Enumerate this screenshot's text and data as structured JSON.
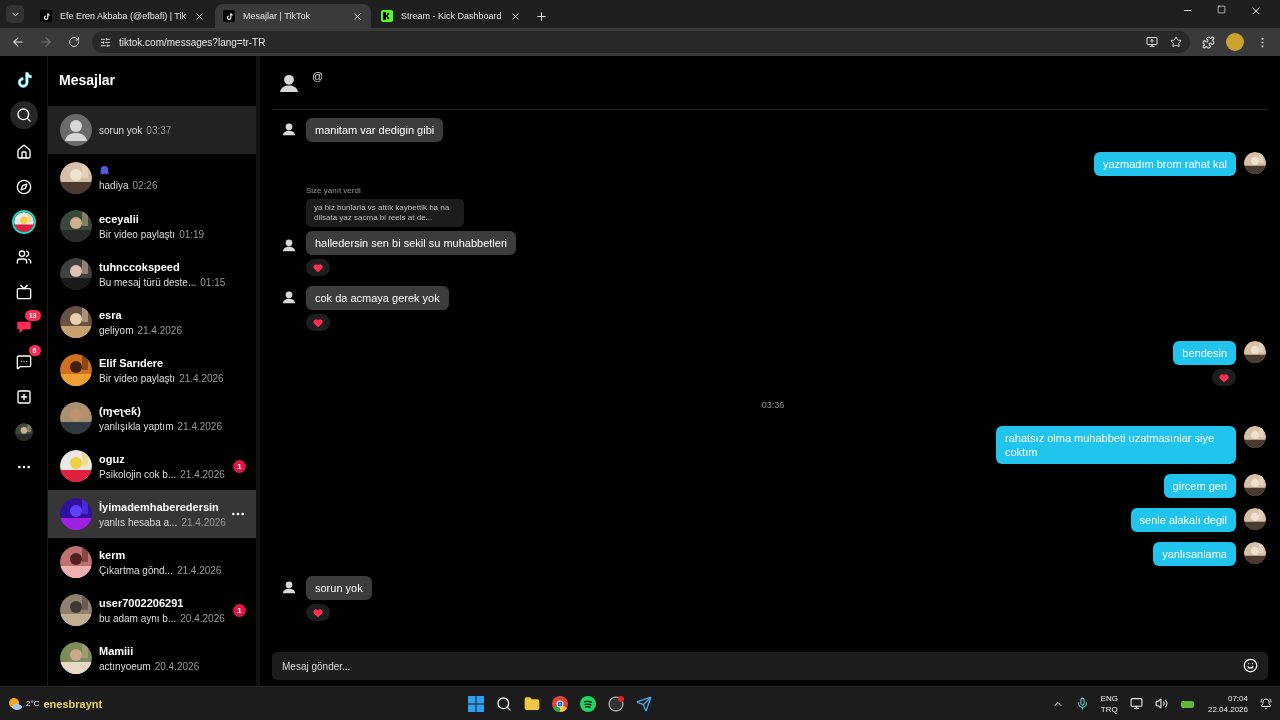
{
  "browser": {
    "tabs": [
      {
        "title": "Efe Eren Akbaba (@efbafi) | Tik",
        "kind": "tiktok",
        "selected": false
      },
      {
        "title": "Mesajlar | TikTok",
        "kind": "tiktok",
        "selected": true
      },
      {
        "title": "Stream - Kick Dashboard",
        "kind": "kick",
        "selected": false
      }
    ],
    "address": "tiktok.com/messages?lang=tr-TR"
  },
  "rail": [
    {
      "kind": "logo"
    },
    {
      "kind": "search",
      "selected": true
    },
    {
      "kind": "home"
    },
    {
      "kind": "explore"
    },
    {
      "kind": "live"
    },
    {
      "kind": "friends"
    },
    {
      "kind": "tv"
    },
    {
      "kind": "activity",
      "badge": "13"
    },
    {
      "kind": "inbox",
      "badge": "6"
    },
    {
      "kind": "upload"
    },
    {
      "kind": "profile"
    },
    {
      "kind": "more"
    }
  ],
  "inbox": {
    "title": "Mesajlar",
    "conversations": [
      {
        "kind": "no-name",
        "preview": "sorun yok",
        "time": "03:37",
        "selected": true,
        "hovered": false
      },
      {
        "kind": "icon-name",
        "preview": "hadiya",
        "time": "02:26",
        "selected": false,
        "hovered": false
      },
      {
        "kind": "text-name",
        "name": "eceyalii",
        "preview": "Bir video paylaştı",
        "time": "01:19",
        "selected": false,
        "hovered": false
      },
      {
        "kind": "text-name",
        "name": "tuhnccokspeed",
        "preview": "Bu mesaj türü deste...",
        "time": "01:15",
        "selected": false,
        "hovered": false
      },
      {
        "kind": "text-name",
        "name": "esra",
        "preview": "geliyom",
        "time": "21.4.2026",
        "selected": false,
        "hovered": false
      },
      {
        "kind": "text-name",
        "name": "Elif Sarıdere",
        "preview": "Bir video paylaştı",
        "time": "21.4.2026",
        "selected": false,
        "hovered": false
      },
      {
        "kind": "text-name",
        "name": "(ɱҽʅҽƙ)",
        "preview": "yanlışıkla yaptım",
        "time": "21.4.2026",
        "selected": false,
        "hovered": false
      },
      {
        "kind": "text-name",
        "name": "oguz",
        "preview": "Psikolojin cok b...",
        "time": "21.4.2026",
        "badge": "1",
        "selected": false,
        "hovered": false
      },
      {
        "kind": "text-name",
        "name": "İyimademhaberedersin",
        "preview": "yanlıs hesaba a...",
        "time": "21.4.2026",
        "selected": false,
        "hovered": true
      },
      {
        "kind": "text-name",
        "name": "kerm",
        "preview": "Çıkartma gönd...",
        "time": "21.4.2026",
        "selected": false,
        "hovered": false
      },
      {
        "kind": "text-name",
        "name": "user7002206291",
        "preview": "bu adam aynı b...",
        "time": "20.4.2026",
        "badge": "1",
        "selected": false,
        "hovered": false
      },
      {
        "kind": "text-name",
        "name": "Mamiii",
        "preview": "actınyoeum",
        "time": "20.4.2026",
        "selected": false,
        "hovered": false
      }
    ]
  },
  "chat": {
    "handle": "@",
    "messages": [
      {
        "kind": "incoming",
        "text": "manitam var dedigin gibi"
      },
      {
        "kind": "outgoing",
        "text": "yazmadım brom rahat kal"
      },
      {
        "kind": "incoming",
        "reply_label": "Size yanıt verdi",
        "quote": "ya biz bunlarla vs attık kaybettik ba na dilsata yaz sacma bi reels at de...",
        "text": "halledersin sen bi sekil su muhabbetleri",
        "reacted": true
      },
      {
        "kind": "incoming",
        "text": "cok da acmaya gerek yok",
        "reacted": true
      },
      {
        "kind": "outgoing",
        "text": "bendesin",
        "reacted": true
      },
      {
        "kind": "time",
        "text": "03:36"
      },
      {
        "kind": "outgoing",
        "text": "rahatsız olma muhabbeti uzatmasınlar siye coktım"
      },
      {
        "kind": "outgoing",
        "text": "gircem geri"
      },
      {
        "kind": "outgoing",
        "text": "senle alakalı degil"
      },
      {
        "kind": "outgoing",
        "text": "yanlısanlama"
      },
      {
        "kind": "incoming",
        "text": "sorun yok",
        "reacted": true
      }
    ],
    "input": {
      "placeholder": "Mesaj gönder..."
    }
  },
  "taskbar": {
    "weather": "2°C",
    "overlay": "enesbraynt",
    "language": [
      "ENG",
      "TRQ"
    ],
    "time": "07:04",
    "date": "22.04.2026"
  }
}
